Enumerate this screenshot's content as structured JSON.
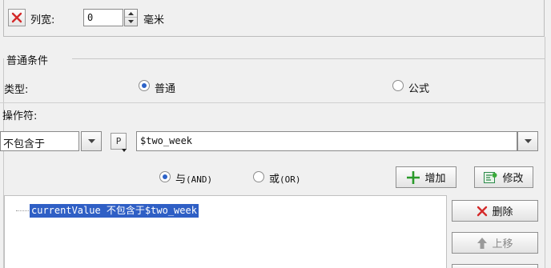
{
  "column": {
    "label": "列宽:",
    "value": "0",
    "unit": "毫米"
  },
  "condition_group": {
    "title": "普通条件",
    "type_label": "类型:",
    "type_options": [
      {
        "label": "普通",
        "selected": true
      },
      {
        "label": "公式",
        "selected": false
      }
    ],
    "operator_label": "操作符:",
    "operator_value": "不包含于",
    "param_button": "P",
    "value_input": "$two_week",
    "logic_options": [
      {
        "label_cn": "与",
        "label_en": "(AND)",
        "selected": true
      },
      {
        "label_cn": "或",
        "label_en": "(OR)",
        "selected": false
      }
    ],
    "buttons": {
      "add": "增加",
      "edit": "修改",
      "delete": "删除",
      "move_up": "上移"
    },
    "tree_items": [
      "currentValue 不包含于$two_week"
    ]
  },
  "colors": {
    "selection": "#2f5fc5",
    "delete_red": "#d42a2a",
    "add_green": "#2a9a2a"
  }
}
